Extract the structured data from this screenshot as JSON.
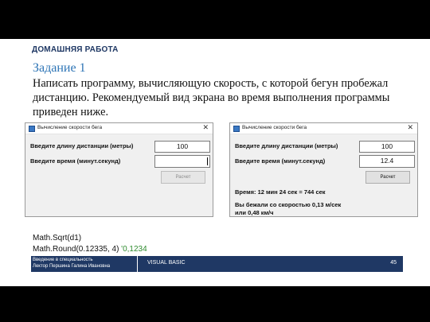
{
  "slide": {
    "section_title": "ДОМАШНЯЯ РАБОТА",
    "task_heading": "Задание 1",
    "task_text": "Написать программу, вычисляющую скорость, с которой бегун пробежал дистанцию. Рекомендуемый вид экрана во время выполнения программы приведен ниже."
  },
  "window_left": {
    "title": "Вычисление скорости бега",
    "close_glyph": "✕",
    "distance_label": "Введите длину дистанции (метры)",
    "distance_value": "100",
    "time_label": "Введите время (минут.секунд)",
    "time_value": "",
    "button_label": "Расчет"
  },
  "window_right": {
    "title": "Вычисление скорости бега",
    "close_glyph": "✕",
    "distance_label": "Введите длину дистанции (метры)",
    "distance_value": "100",
    "time_label": "Введите время (минут.секунд)",
    "time_value": "12.4",
    "button_label": "Расчет",
    "result_time": "Время: 12 мин 24 сек = 744 сек",
    "result_speed_line1": "Вы бежали со скоростью 0,13 м/сек",
    "result_speed_line2": "или 0,48 км/ч"
  },
  "code": {
    "line1": "Math.Sqrt(d1)",
    "line2_code": "Math.Round(0.12335, 4)",
    "line2_comment": " '0,1234"
  },
  "footer": {
    "course_line1": "Введение в специальность",
    "course_line2": "Лектор Першина Галина Ивановна",
    "subject": "VISUAL BASIC",
    "page_number": "45"
  },
  "colors": {
    "footer_bg": "#1f3864",
    "heading_blue": "#2e75b6",
    "comment_green": "#2e8b2e"
  }
}
